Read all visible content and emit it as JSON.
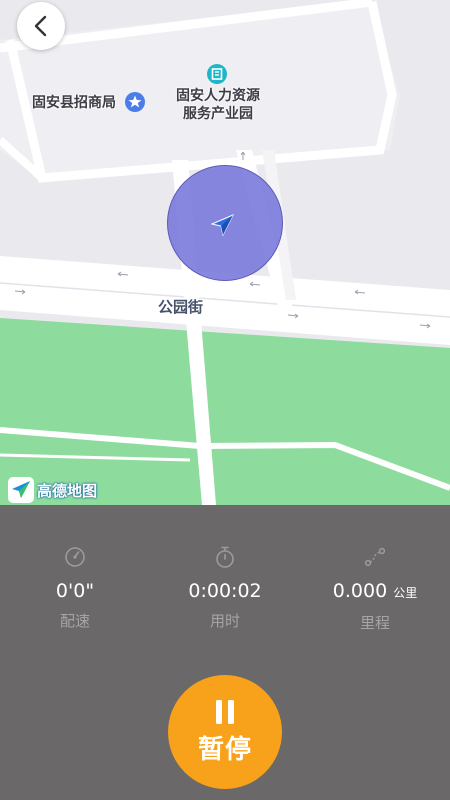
{
  "map": {
    "poi_investment_bureau": "固安县招商局",
    "poi_hr_park_line1": "固安人力资源",
    "poi_hr_park_line2": "服务产业园",
    "road_name": "公园街",
    "provider_logo_text": "高德地图",
    "colors": {
      "background": "#e9e9ee",
      "road": "#ffffff",
      "park": "#8ddc9e",
      "accuracy_circle": "#7b79dd",
      "location_arrow": "#2f6be0"
    }
  },
  "nav": {
    "back_icon": "chevron-left-icon"
  },
  "stats": {
    "pace": {
      "icon": "speedometer-icon",
      "value": "0'0\"",
      "label": "配速"
    },
    "duration": {
      "icon": "stopwatch-icon",
      "value": "0:00:02",
      "label": "用时"
    },
    "distance": {
      "icon": "route-icon",
      "value": "0.000",
      "unit": "公里",
      "label": "里程"
    }
  },
  "controls": {
    "pause_icon": "pause-icon",
    "pause_label": "暂停",
    "pause_color": "#f7a21a"
  },
  "panel_color": "#6a6869"
}
